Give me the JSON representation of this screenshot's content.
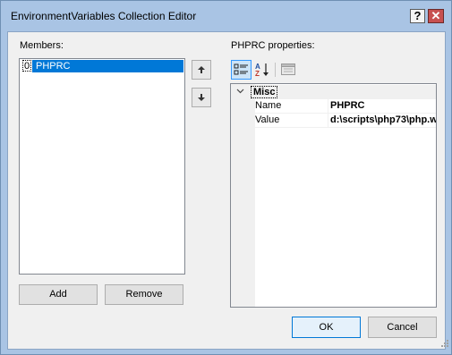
{
  "window": {
    "title": "EnvironmentVariables Collection Editor",
    "help_label": "?",
    "close_label": "✕"
  },
  "members": {
    "label": "Members:",
    "items": [
      {
        "index": "0",
        "name": "PHPRC",
        "selected": true
      }
    ],
    "add_label": "Add",
    "remove_label": "Remove"
  },
  "properties": {
    "label": "PHPRC properties:",
    "category": "Misc",
    "rows": [
      {
        "name": "Name",
        "value": "PHPRC"
      },
      {
        "name": "Value",
        "value": "d:\\scripts\\php73\\php.w"
      }
    ]
  },
  "footer": {
    "ok_label": "OK",
    "cancel_label": "Cancel"
  },
  "colors": {
    "selection": "#0078d7",
    "frame": "#a9c4e4",
    "close": "#c75050"
  }
}
